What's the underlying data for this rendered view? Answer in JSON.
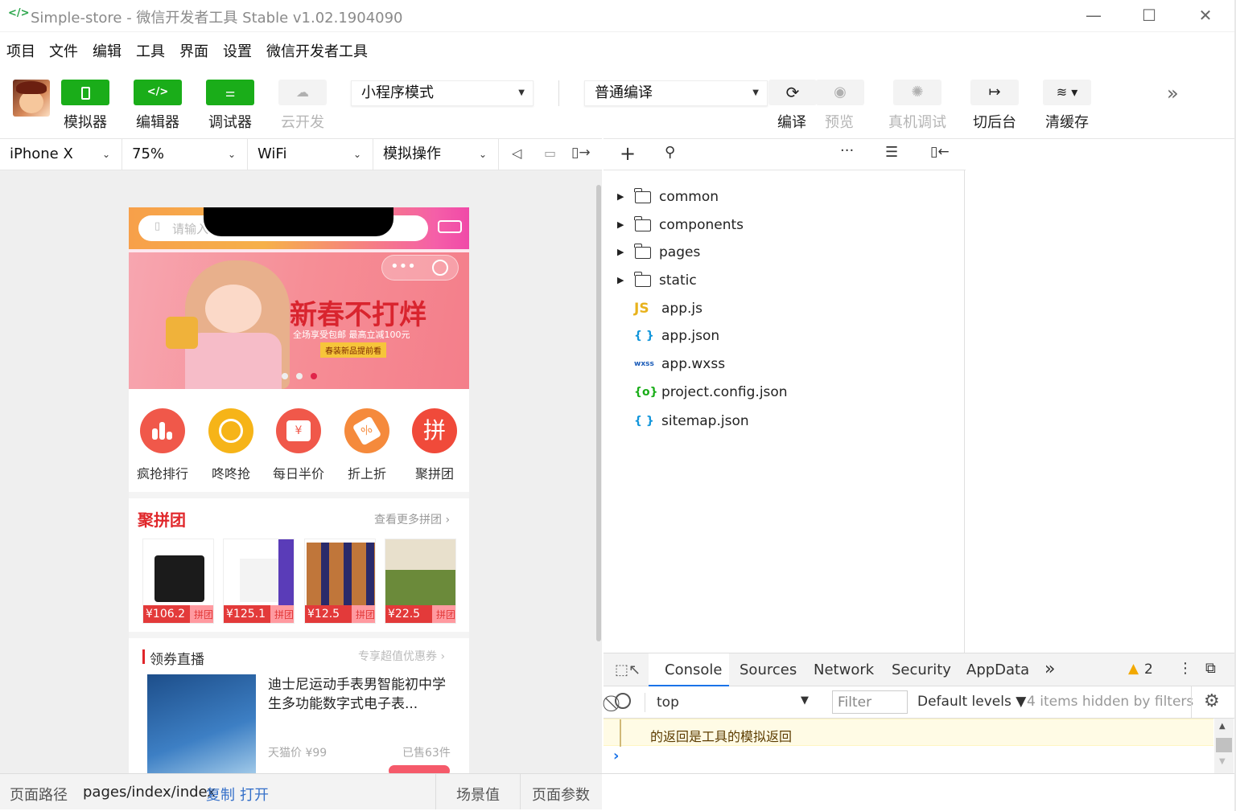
{
  "window": {
    "title": "Simple-store - 微信开发者工具 Stable v1.02.1904090",
    "app_icon": "</>"
  },
  "menu": [
    "项目",
    "文件",
    "编辑",
    "工具",
    "界面",
    "设置",
    "微信开发者工具"
  ],
  "toolbar": {
    "simulator_label": "模拟器",
    "editor_label": "编辑器",
    "debugger_label": "调试器",
    "cloud_label": "云开发",
    "mode_select": "小程序模式",
    "compile_select": "普通编译",
    "compile_label": "编译",
    "preview_label": "预览",
    "remote_debug_label": "真机调试",
    "background_label": "切后台",
    "clear_cache_label": "清缓存",
    "editor_icon": "</>"
  },
  "device_bar": {
    "device": "iPhone X",
    "zoom": "75%",
    "network": "WiFi",
    "operation": "模拟操作"
  },
  "phone": {
    "search_placeholder": "请输入",
    "banner_title": "新春不打烊",
    "banner_sub": "全场享受包邮 最高立减100元",
    "banner_btn": "春装新品提前看",
    "categories": [
      {
        "label": "疯抢排行",
        "color": "#f0584a"
      },
      {
        "label": "咚咚抢",
        "color": "#f6b418"
      },
      {
        "label": "每日半价",
        "color": "#f0584a"
      },
      {
        "label": "折上折",
        "color": "#f58a3c"
      },
      {
        "label": "聚拼团",
        "color": "#f04a3a"
      }
    ],
    "cat_glyphs": [
      "",
      "",
      "¥",
      "%",
      "拼"
    ],
    "group_title": "聚拼团",
    "group_more": "查看更多拼团 ›",
    "group_items": [
      {
        "price": "¥106.2",
        "tag": "拼团"
      },
      {
        "price": "¥125.1",
        "tag": "拼团"
      },
      {
        "price": "¥12.5",
        "tag": "拼团"
      },
      {
        "price": "¥22.5",
        "tag": "拼团"
      }
    ],
    "coupon_title": "领券直播",
    "coupon_more": "专享超值优惠券 ›",
    "product_title": "迪士尼运动手表男智能初中学生多功能数字式电子表...",
    "product_price": "天猫价 ¥99",
    "product_sold": "已售63件"
  },
  "tree": [
    {
      "name": "common",
      "type": "folder"
    },
    {
      "name": "components",
      "type": "folder"
    },
    {
      "name": "pages",
      "type": "folder"
    },
    {
      "name": "static",
      "type": "folder"
    },
    {
      "name": "app.js",
      "type": "js",
      "icon": "JS",
      "color": "#e8b21c"
    },
    {
      "name": "app.json",
      "type": "json",
      "icon": "{ }",
      "color": "#1296db"
    },
    {
      "name": "app.wxss",
      "type": "wxss",
      "icon": "wxss",
      "color": "#1a5bb8"
    },
    {
      "name": "project.config.json",
      "type": "config",
      "icon": "{o}",
      "color": "#1aad19"
    },
    {
      "name": "sitemap.json",
      "type": "json",
      "icon": "{ }",
      "color": "#1296db"
    }
  ],
  "console": {
    "tabs": [
      "Console",
      "Sources",
      "Network",
      "Security",
      "AppData"
    ],
    "warn_count": "2",
    "context": "top",
    "filter_placeholder": "Filter",
    "levels": "Default levels ▼",
    "hidden": "4 items hidden by filters",
    "warn_line": "的返回是工具的模拟返回",
    "prompt": "›"
  },
  "status": {
    "path_label": "页面路径",
    "path": "pages/index/index",
    "copy": "复制",
    "open": "打开",
    "scene": "场景值",
    "params": "页面参数"
  }
}
